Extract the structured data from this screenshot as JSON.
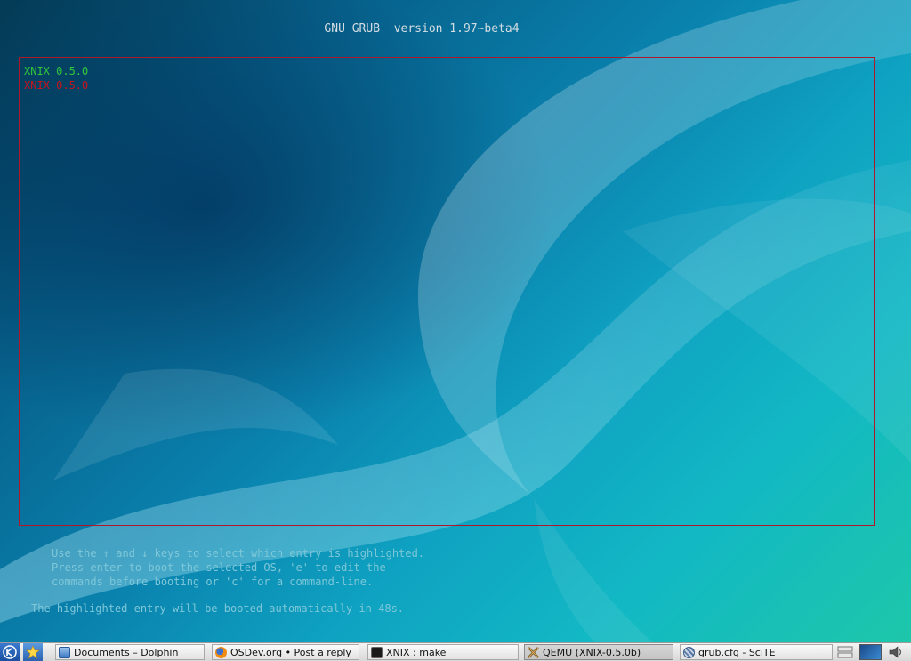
{
  "grub": {
    "title": "GNU GRUB  version 1.97~beta4",
    "entries": [
      "XNIX 0.5.0",
      "XNIX 0.5.0"
    ],
    "help_lines": [
      "Use the ↑ and ↓ keys to select which entry is highlighted.",
      "Press enter to boot the selected OS, 'e' to edit the",
      "commands before booting or 'c' for a command-line."
    ],
    "countdown": "The highlighted entry will be booted automatically in 48s.",
    "colors": {
      "selected_entry": "#2fc83a",
      "entry": "#c8141e",
      "border": "#b0182a",
      "help_text": "#7ec7d8"
    }
  },
  "taskbar": {
    "launchers": [
      {
        "icon": "kde-menu-icon"
      },
      {
        "icon": "favorites-star-icon"
      }
    ],
    "tasks": [
      {
        "label": "Documents – Dolphin",
        "icon": "dolphin-icon"
      },
      {
        "label": "OSDev.org • Post a reply",
        "icon": "firefox-icon"
      },
      {
        "label": "XNIX : make",
        "icon": "terminal-icon"
      },
      {
        "label": "QEMU (XNIX-0.5.0b)",
        "icon": "qemu-icon",
        "active": true
      },
      {
        "label": "grub.cfg - SciTE",
        "icon": "scite-icon"
      }
    ],
    "tray": [
      "pager-icon",
      "desktop-preview",
      "volume-icon"
    ]
  }
}
